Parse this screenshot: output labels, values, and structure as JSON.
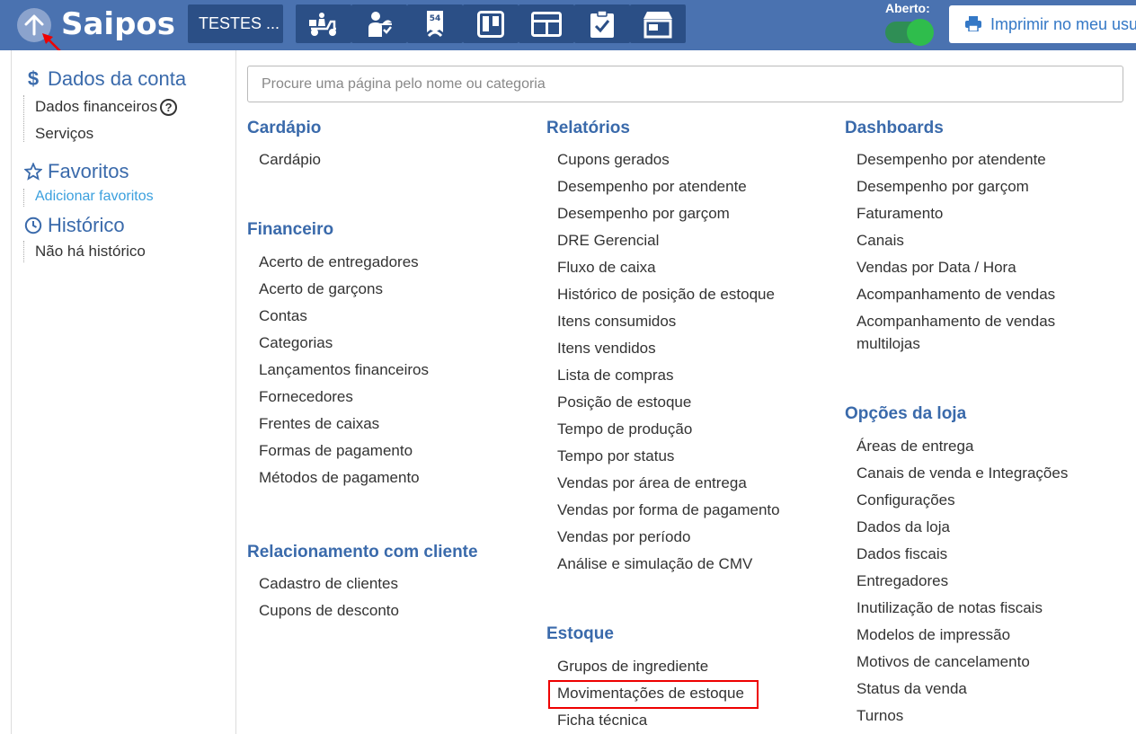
{
  "topbar": {
    "logo": "Saipos",
    "store_label": "TESTES ...",
    "open_label": "Aberto:",
    "print_label": "Imprimir no meu usuário",
    "nav_icons": [
      "delivery-icon",
      "waiter-icon",
      "receipt-icon",
      "kanban-icon",
      "display-icon",
      "checklist-icon",
      "store-icon"
    ],
    "colors": {
      "bar": "#4a72b0",
      "button": "#2b4f86",
      "toggle_on": "#2fbd4c"
    }
  },
  "left_panel": {
    "account": {
      "title": "Dados da conta",
      "items": [
        "Dados financeiros",
        "Serviços"
      ]
    },
    "favorites": {
      "title": "Favoritos",
      "add_link": "Adicionar favoritos"
    },
    "history": {
      "title": "Histórico",
      "empty": "Não há histórico"
    }
  },
  "search": {
    "placeholder": "Procure uma página pelo nome ou categoria"
  },
  "sections": {
    "cardapio": {
      "title": "Cardápio",
      "items": [
        "Cardápio"
      ]
    },
    "financeiro": {
      "title": "Financeiro",
      "items": [
        "Acerto de entregadores",
        "Acerto de garçons",
        "Contas",
        "Categorias",
        "Lançamentos financeiros",
        "Fornecedores",
        "Frentes de caixas",
        "Formas de pagamento",
        "Métodos de pagamento"
      ]
    },
    "relacionamento": {
      "title": "Relacionamento com cliente",
      "items": [
        "Cadastro de clientes",
        "Cupons de desconto"
      ]
    },
    "relatorios": {
      "title": "Relatórios",
      "items": [
        "Cupons gerados",
        "Desempenho por atendente",
        "Desempenho por garçom",
        "DRE Gerencial",
        "Fluxo de caixa",
        "Histórico de posição de estoque",
        "Itens consumidos",
        "Itens vendidos",
        "Lista de compras",
        "Posição de estoque",
        "Tempo de produção",
        "Tempo por status",
        "Vendas por área de entrega",
        "Vendas por forma de pagamento",
        "Vendas por período",
        "Análise e simulação de CMV"
      ]
    },
    "estoque": {
      "title": "Estoque",
      "items": [
        "Grupos de ingrediente",
        "Movimentações de estoque",
        "Ficha técnica"
      ]
    },
    "dashboards": {
      "title": "Dashboards",
      "items": [
        "Desempenho por atendente",
        "Desempenho por garçom",
        "Faturamento",
        "Canais",
        "Vendas por Data / Hora",
        "Acompanhamento de vendas",
        "Acompanhamento de vendas multilojas"
      ]
    },
    "opcoes": {
      "title": "Opções da loja",
      "items": [
        "Áreas de entrega",
        "Canais de venda e Integrações",
        "Configurações",
        "Dados da loja",
        "Dados fiscais",
        "Entregadores",
        "Inutilização de notas fiscais",
        "Modelos de impressão",
        "Motivos de cancelamento",
        "Status da venda",
        "Turnos"
      ]
    }
  },
  "highlight_color": "#e00000"
}
